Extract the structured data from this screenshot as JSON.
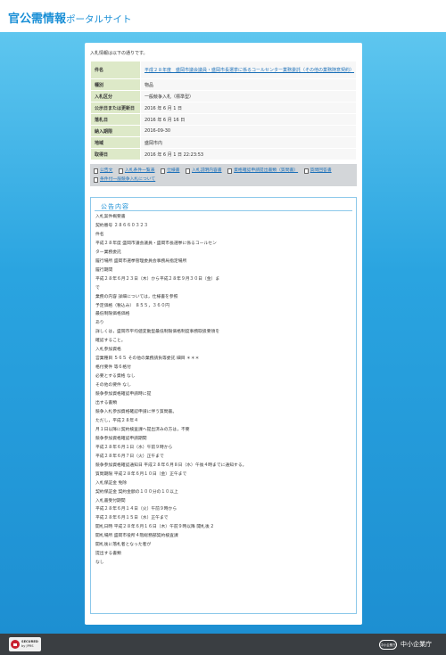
{
  "header": {
    "logo_main": "官公需情報",
    "logo_sub": "ポータルサイト"
  },
  "intro": "入札情報は以下の通りです。",
  "info_rows": [
    {
      "key": "件名",
      "value": "平成２８年度　盛岡市議会議員・盛岡市長選挙に係るコールセンター業務委託（その他の業務随意契約）",
      "link": true
    },
    {
      "key": "種別",
      "value": "物品",
      "link": false
    },
    {
      "key": "入札区分",
      "value": "一般競争入札（標準型）",
      "link": false
    },
    {
      "key": "公示日または更新日",
      "value": "2016 年 6 月 1 日",
      "link": false
    },
    {
      "key": "落札日",
      "value": "2016 年 6 月 16 日",
      "link": false
    },
    {
      "key": "納入期限",
      "value": "2016-09-30",
      "link": false
    },
    {
      "key": "地域",
      "value": "盛岡市内",
      "link": false
    },
    {
      "key": "取得日",
      "value": "2016 年 6 月 1 日 22:23:53",
      "link": false
    }
  ],
  "doc_links": [
    "公告文",
    "入札条件一覧表",
    "仕様書",
    "入札説明内容書",
    "資格確認申請提出書類（質問書）",
    "質問回答書",
    "条件付一般競争入札について"
  ],
  "notice": {
    "title": "公告内容",
    "lines": [
      "入札案件概要書",
      "契約番号 ２８６６０３２３",
      "件名",
      "平成２８年度 盛岡市議会議員・盛岡市長選挙に係るコールセン",
      "ター業務委託",
      "履行場所 盛岡市選挙管理委員会事務局指定場所",
      "履行期間",
      "平成２８年６月２３日（木）から平成２８年９月３０日（金）ま",
      "で",
      "業務の内容 詳細については，仕様書を参照",
      "予定価格（税込み） ８５５，３６０円",
      "最低制限価格価格",
      "あり",
      "詳しくは，盛岡市平均値変動型最低制限価格制度事務取扱要領を",
      "確認すること。",
      "入札参加資格",
      "営業種目 ５６５ その他の業務請負等委託 細目 ＊＊＊",
      "格付要件 等６格付",
      "必要とする資格 なし",
      "その他の要件 なし",
      "競争参加資格確認申請時に提",
      "出する書類",
      "競争入札参加資格確認申請に伴う質問書。",
      "ただし，平成２８年４",
      "月１日以降に契約検査課へ提出済みの方は，不要",
      "競争参加資格確認申請期間",
      "平成２８年６月１日（水）午前９時から",
      "平成２８年６月７日（火）正午まで",
      "競争参加資格確認通知日 平成２８年６月８日（水）午後４時までに通知する。",
      "質問期限 平成２８年６月１０日（金）正午まで",
      "入札保証金 免除",
      "契約保証金 契約金額の１００分の１０以上",
      "入札書受付期間",
      "平成２８年６月１４日（火）午前９時から",
      "平成２８年６月１５日（水）正午まで",
      "開札日時 平成２８年６月１６日（木）午前９時以降 開札後 2",
      "開札場所 盛岡市役所４階総務部契約検査課",
      "開札後に落札者となった者が",
      "提出する書類",
      "なし"
    ]
  },
  "footer": {
    "secured_line1": "SECURED",
    "secured_line2": "by JPRS",
    "org_mark": "中小企業庁",
    "org_name": "中小企業庁"
  },
  "colors": {
    "accent": "#1a8fd6",
    "key_bg": "#dde9c8",
    "footer_bg": "#3a3e42"
  }
}
